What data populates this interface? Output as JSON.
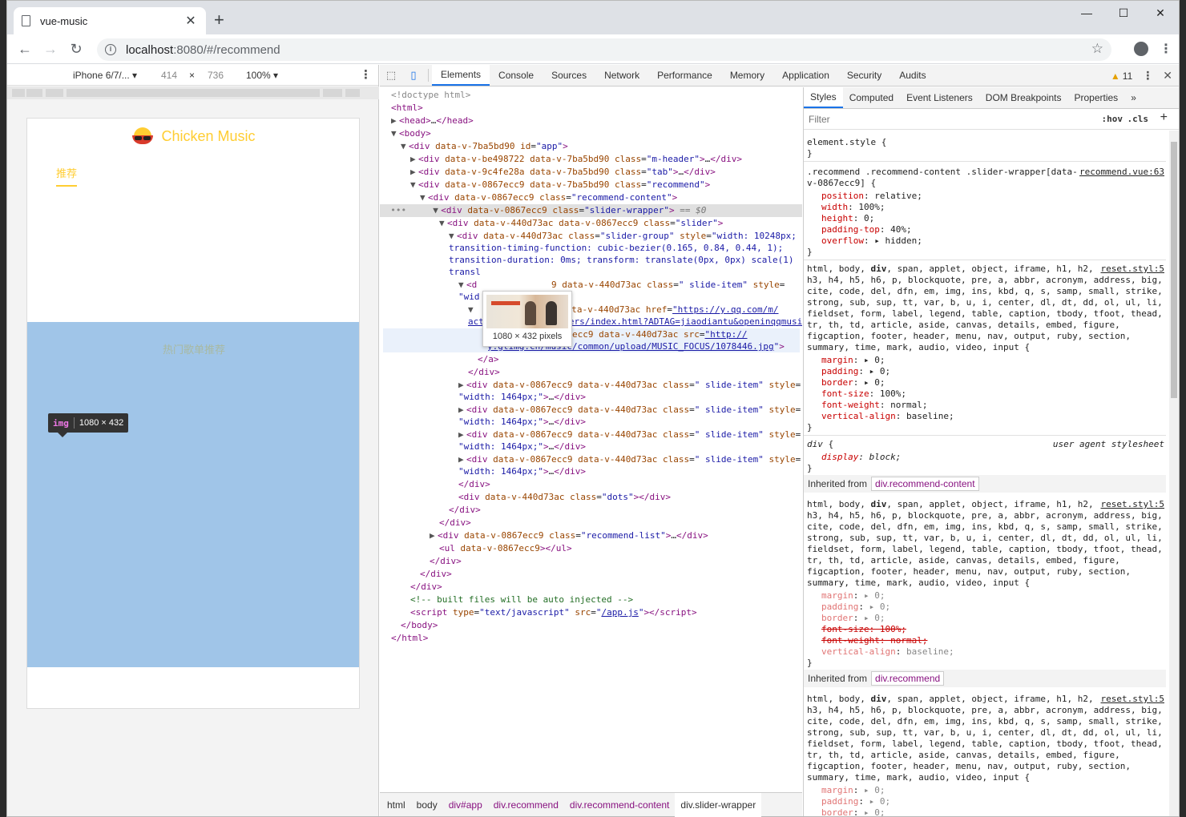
{
  "browser": {
    "tab_title": "vue-music",
    "url_host": "localhost",
    "url_path": ":8080/#/recommend"
  },
  "device_toolbar": {
    "device": "iPhone 6/7/...",
    "width": "414",
    "times": "×",
    "height": "736",
    "zoom": "100%"
  },
  "app": {
    "brand": "Chicken Music",
    "tab": "推荐",
    "section_title": "热门歌单推荐",
    "inspect_tag": "img",
    "inspect_size": "1080 × 432"
  },
  "devtools": {
    "tabs": [
      "Elements",
      "Console",
      "Sources",
      "Network",
      "Performance",
      "Memory",
      "Application",
      "Security",
      "Audits"
    ],
    "warnings": "11",
    "preview_caption": "1080 × 432 pixels",
    "breadcrumbs": [
      "html",
      "body",
      "div#app",
      "div.recommend",
      "div.recommend-content",
      "div.slider-wrapper"
    ]
  },
  "styles_panel": {
    "tabs": [
      "Styles",
      "Computed",
      "Event Listeners",
      "DOM Breakpoints",
      "Properties"
    ],
    "filter_placeholder": "Filter",
    "hov": ":hov",
    "cls": ".cls",
    "element_style": "element.style {",
    "rule1_selector_a": ".recommend .recommend-content .slider-wrapper[data-",
    "rule1_selector_b": "v-0867ecc9] {",
    "rule1_source": "recommend.vue:63",
    "reset_source": "reset.styl:5",
    "ua_label": "user agent stylesheet",
    "inherited_from": "Inherited from",
    "inherit1": "div.recommend-content",
    "inherit2": "div.recommend"
  }
}
